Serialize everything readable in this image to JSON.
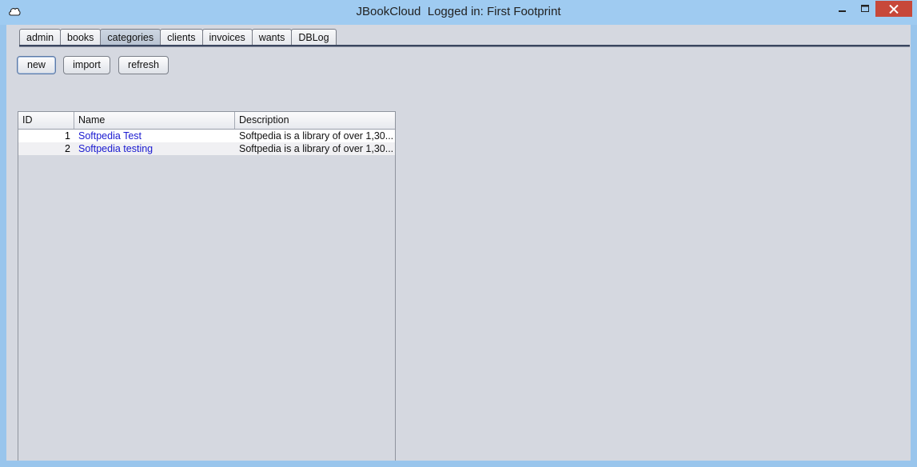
{
  "window": {
    "title": "JBookCloud  Logged in: First Footprint"
  },
  "tabs": [
    {
      "label": "admin"
    },
    {
      "label": "books"
    },
    {
      "label": "categories",
      "active": true
    },
    {
      "label": "clients"
    },
    {
      "label": "invoices"
    },
    {
      "label": "wants"
    },
    {
      "label": "DBLog"
    }
  ],
  "toolbar": {
    "new_label": "new",
    "import_label": "import",
    "refresh_label": "refresh"
  },
  "table": {
    "columns": [
      "ID",
      "Name",
      "Description"
    ],
    "rows": [
      {
        "id": "1",
        "name": "Softpedia Test",
        "description": "Softpedia is a library of over 1,30..."
      },
      {
        "id": "2",
        "name": "Softpedia testing",
        "description": "Softpedia is a library of over 1,30..."
      }
    ]
  },
  "colors": {
    "titlebar": "#9fcbf1",
    "client_bg": "#d5d8e0",
    "close_button": "#c7483a",
    "name_link": "#1a1ad0"
  },
  "icons": {
    "app": "cloud-icon",
    "minimize": "minimize-icon",
    "maximize": "maximize-icon",
    "close": "close-icon"
  }
}
